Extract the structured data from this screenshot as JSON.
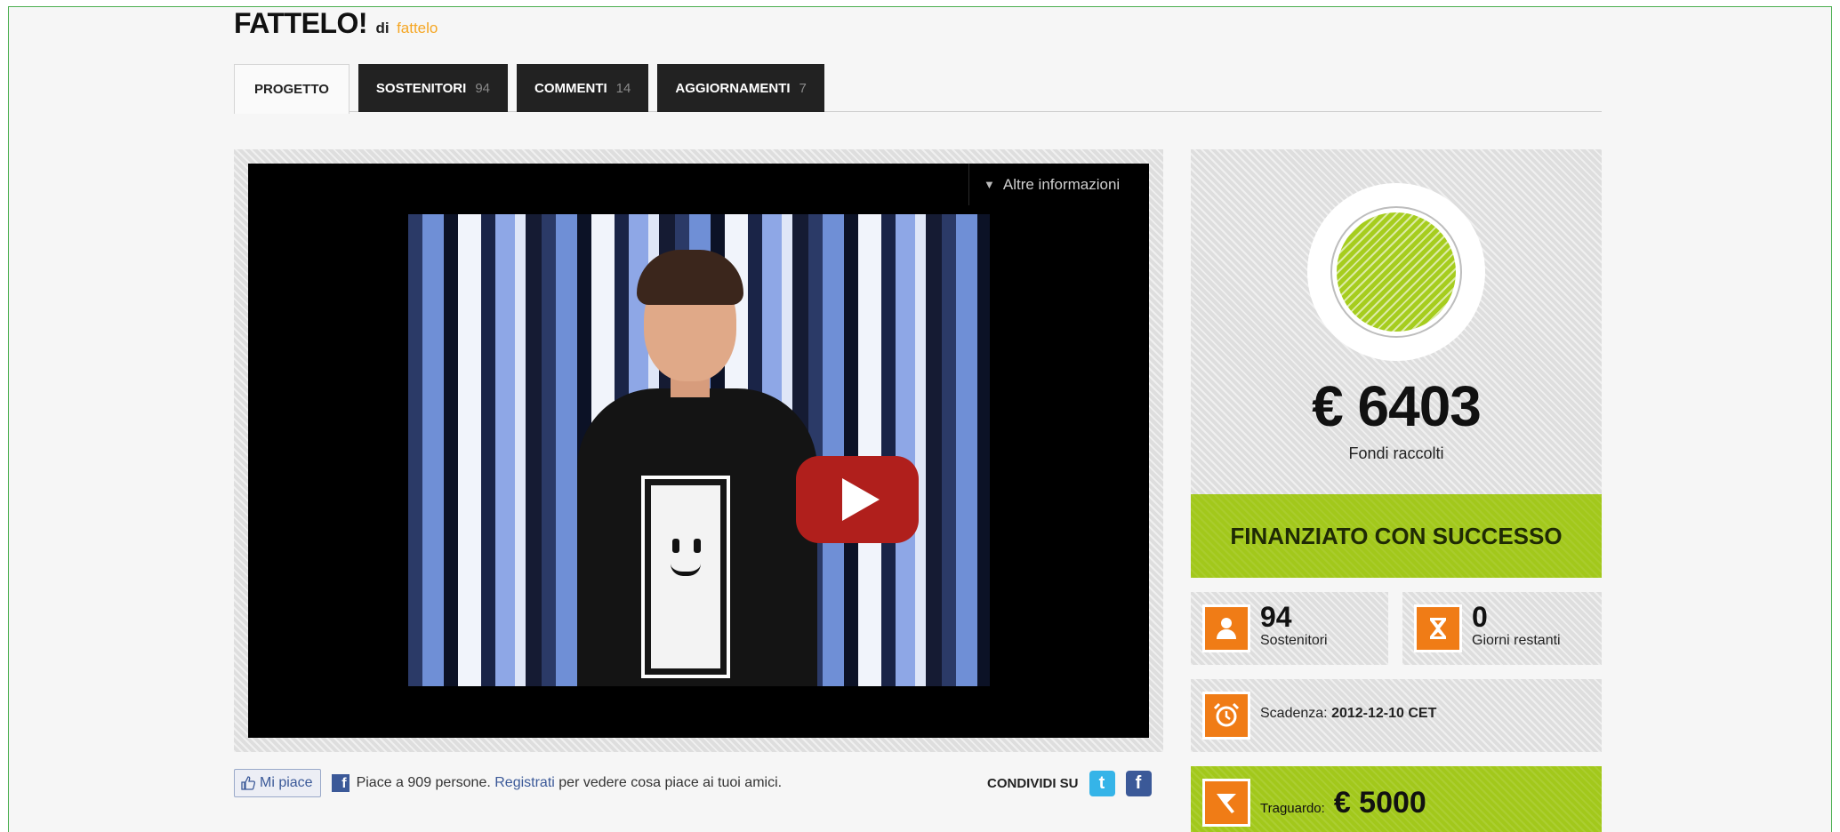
{
  "project": {
    "title": "FATTELO!",
    "by_label": "di",
    "author": "fattelo"
  },
  "tabs": [
    {
      "label": "PROGETTO",
      "count": ""
    },
    {
      "label": "SOSTENITORI",
      "count": "94"
    },
    {
      "label": "COMMENTI",
      "count": "14"
    },
    {
      "label": "AGGIORNAMENTI",
      "count": "7"
    }
  ],
  "video": {
    "more_info": "Altre informazioni"
  },
  "social": {
    "like_button": "Mi piace",
    "like_count_text": "Piace a 909 persone.",
    "register_link": "Registrati",
    "like_suffix": "per vedere cosa piace ai tuoi amici.",
    "share_label": "CONDIVIDI SU"
  },
  "funding": {
    "amount": "€ 6403",
    "amount_label": "Fondi raccolti",
    "status": "FINANZIATO CON SUCCESSO",
    "progress_fraction": 1.0
  },
  "stats": {
    "backers": {
      "value": "94",
      "label": "Sostenitori"
    },
    "days_left": {
      "value": "0",
      "label": "Giorni restanti"
    },
    "deadline": {
      "label": "Scadenza:",
      "value": "2012-12-10 CET"
    },
    "goal": {
      "label": "Traguardo:",
      "value": "€ 5000"
    }
  },
  "colors": {
    "accent_green": "#a2c81b",
    "icon_orange": "#f07c16",
    "author_orange": "#f5a623",
    "frame_border": "#4caf50"
  },
  "icons": [
    "play-icon",
    "more-info-arrows-icon",
    "thumbs-up-icon",
    "facebook-icon",
    "twitter-icon",
    "user-icon",
    "hourglass-icon",
    "alarm-clock-icon",
    "flag-icon"
  ]
}
